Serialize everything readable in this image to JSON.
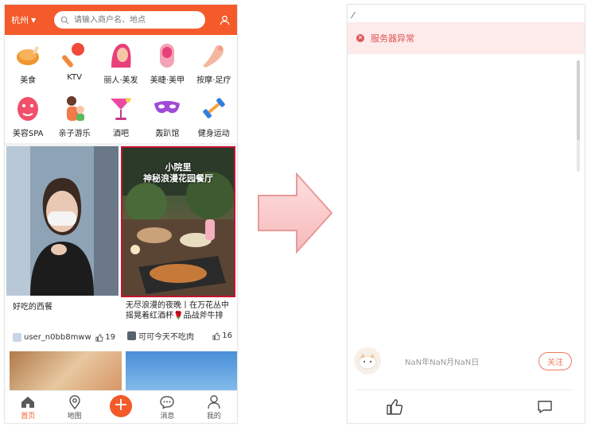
{
  "left_app": {
    "header": {
      "city": "杭州",
      "search_placeholder": "请输入商户名、地点"
    },
    "categories": [
      {
        "label": "美食",
        "icon": "food-icon"
      },
      {
        "label": "KTV",
        "icon": "microphone-icon"
      },
      {
        "label": "丽人·美发",
        "icon": "hair-icon"
      },
      {
        "label": "美睫·美甲",
        "icon": "nail-icon"
      },
      {
        "label": "按摩·足疗",
        "icon": "massage-icon"
      },
      {
        "label": "美容SPA",
        "icon": "spa-icon"
      },
      {
        "label": "亲子游乐",
        "icon": "family-icon"
      },
      {
        "label": "酒吧",
        "icon": "cocktail-icon"
      },
      {
        "label": "轰趴馆",
        "icon": "mask-icon"
      },
      {
        "label": "健身运动",
        "icon": "dumbbell-icon"
      }
    ],
    "feed": [
      {
        "title": "好吃的西餐",
        "author": "user_n0bb8mww",
        "likes": "19"
      },
      {
        "photo_text_1": "小院里",
        "photo_text_2": "神秘浪漫花园餐厅",
        "title": "无尽浪漫的夜晚丨在万花丛中摇晃着红酒杯🌹品战斧牛排",
        "author": "可可今天不吃肉",
        "likes": "16"
      }
    ],
    "tabbar": [
      {
        "label": "首页",
        "icon": "home-icon"
      },
      {
        "label": "地图",
        "icon": "map-pin-icon"
      },
      {
        "label": "",
        "icon": "add-icon"
      },
      {
        "label": "消息",
        "icon": "message-icon"
      },
      {
        "label": "我的",
        "icon": "user-icon"
      }
    ],
    "colors": {
      "brand": "#f45a2a",
      "selection_border": "#c8102e"
    }
  },
  "right_app": {
    "error_message": "服务器异常",
    "date_text": "NaN年NaN月NaN日",
    "follow_label": "关注",
    "colors": {
      "error": "#e05555",
      "follow": "#f07a5a"
    }
  }
}
